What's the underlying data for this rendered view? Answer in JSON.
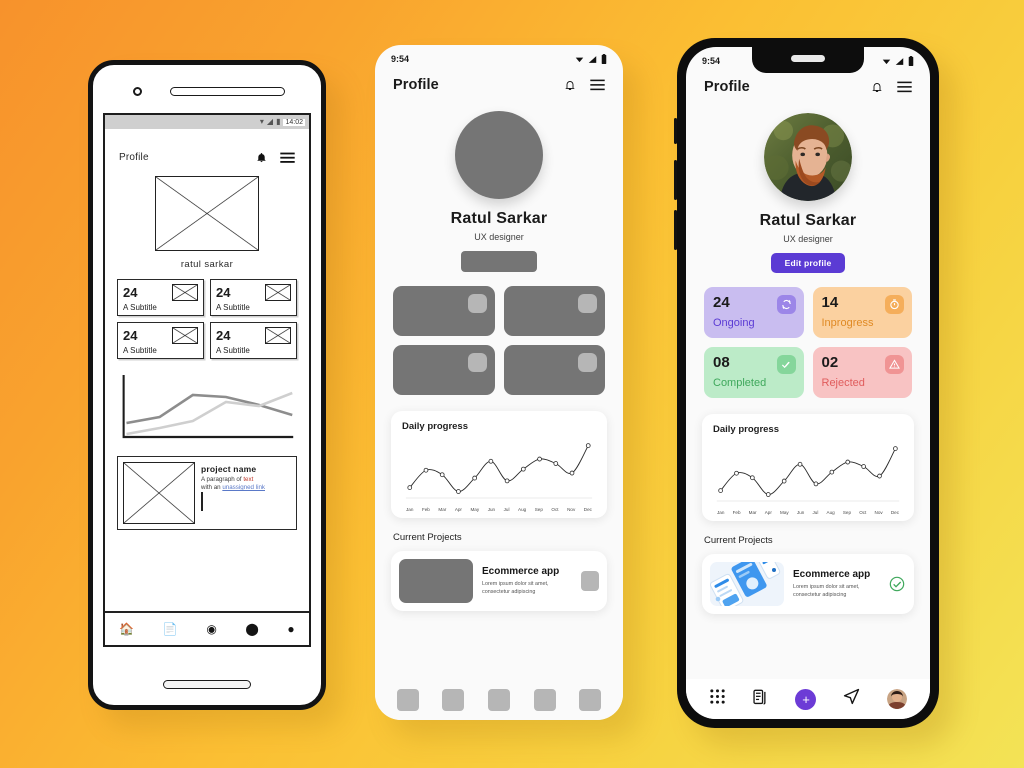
{
  "canvas": {
    "background_from": "#f7922c",
    "background_to": "#f3e356"
  },
  "phones": {
    "left": {
      "kind": "wireframe",
      "status": {
        "time": "14:02",
        "wifi": "wifi-icon",
        "signal": "signal-icon",
        "battery": "battery-icon"
      },
      "appbar": {
        "title": "Profile",
        "bell": "bell-icon",
        "menu": "hamburger-menu-icon"
      },
      "profile": {
        "name": "ratul  sarkar"
      },
      "stats": [
        {
          "num": "24",
          "label": "A Subtitle"
        },
        {
          "num": "24",
          "label": "A Subtitle"
        },
        {
          "num": "24",
          "label": "A Subtitle"
        },
        {
          "num": "24",
          "label": "A Subtitle"
        }
      ],
      "project": {
        "title": "project name",
        "line1_a": "A paragraph of ",
        "line1_b": "text",
        "line2_a": "with an ",
        "line2_b": "unassigned link"
      },
      "nav": [
        "home-icon",
        "document-icon",
        "refresh-icon",
        "chat-icon",
        "account-icon"
      ]
    },
    "middle": {
      "kind": "greyscale",
      "status": {
        "time": "9:54"
      },
      "appbar": {
        "title": "Profile",
        "bell": "bell-icon",
        "menu": "hamburger-menu-icon"
      },
      "profile": {
        "name": "Ratul Sarkar",
        "role": "UX designer",
        "edit_label": ""
      },
      "stats": [
        {
          "num": "",
          "label": ""
        },
        {
          "num": "",
          "label": ""
        },
        {
          "num": "",
          "label": ""
        },
        {
          "num": "",
          "label": ""
        }
      ],
      "chart_card_title": "Daily progress",
      "section_title": "Current Projects",
      "project": {
        "name": "Ecommerce app",
        "desc": "Lorem ipsum dolor sit amet, consectetur adipiscing"
      },
      "nav_placeholders": 5
    },
    "right": {
      "kind": "color",
      "status": {
        "time": "9:54"
      },
      "appbar": {
        "title": "Profile",
        "bell": "bell-icon",
        "menu": "hamburger-menu-icon"
      },
      "profile": {
        "name": "Ratul Sarkar",
        "role": "UX designer",
        "edit_label": "Edit profile",
        "edit_color": "#5B3BD4"
      },
      "stats": [
        {
          "num": "24",
          "label": "Ongoing",
          "bg": "#C9BDF0",
          "fg": "#5B3BD4",
          "badge_bg": "#9C86E8",
          "icon": "sync-icon"
        },
        {
          "num": "14",
          "label": "Inprogress",
          "bg": "#FBD1A0",
          "fg": "#E08A24",
          "badge_bg": "#F5AE5B",
          "icon": "timer-icon"
        },
        {
          "num": "08",
          "label": "Completed",
          "bg": "#BCEBC8",
          "fg": "#3FA85C",
          "badge_bg": "#85D69B",
          "icon": "check-icon"
        },
        {
          "num": "02",
          "label": "Rejected",
          "bg": "#F8C3C3",
          "fg": "#E05C5C",
          "badge_bg": "#F09494",
          "icon": "warning-icon"
        }
      ],
      "chart_card_title": "Daily progress",
      "section_title": "Current Projects",
      "project": {
        "name": "Ecommerce app",
        "desc": "Lorem ipsum dolor sit amet, consectetur adipiscing",
        "status_icon": "check-circle-icon"
      },
      "nav": [
        "grid-apps-icon",
        "documents-icon",
        "add-fab-icon",
        "send-icon",
        "profile-avatar-icon"
      ]
    }
  },
  "chart_data": {
    "type": "line",
    "title": "Daily progress",
    "categories": [
      "Jan",
      "Feb",
      "Mar",
      "Apr",
      "May",
      "Jun",
      "Jul",
      "Aug",
      "Sep",
      "Oct",
      "Nov",
      "Dec"
    ],
    "values": [
      15,
      46,
      38,
      8,
      32,
      62,
      27,
      48,
      66,
      58,
      41,
      90
    ],
    "xlabel": "",
    "ylabel": "",
    "ylim": [
      0,
      100
    ],
    "grid": false,
    "legend": "none",
    "markers": "circle",
    "line_color": "#2b2b2b"
  }
}
